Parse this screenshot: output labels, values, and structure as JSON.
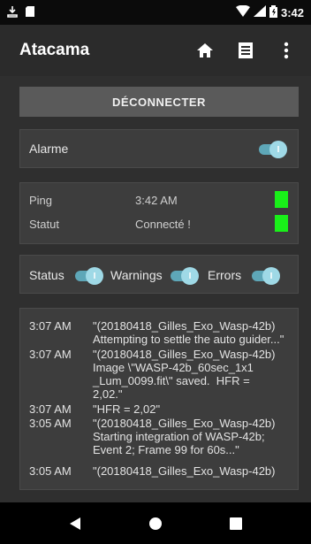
{
  "statusbar": {
    "time": "3:42"
  },
  "appbar": {
    "title": "Atacama"
  },
  "disconnect": {
    "label": "DÉCONNECTER"
  },
  "alarm": {
    "label": "Alarme",
    "enabled": true
  },
  "status_card": {
    "ping_label": "Ping",
    "ping_value": "3:42 AM",
    "status_label": "Statut",
    "status_value": "Connecté !"
  },
  "filters": [
    {
      "label": "Status",
      "enabled": true
    },
    {
      "label": "Warnings",
      "enabled": true
    },
    {
      "label": "Errors",
      "enabled": true
    }
  ],
  "log": [
    {
      "time": "3:07 AM",
      "message": "\"(20180418_Gilles_Exo_Wasp-42b)\nAttempting to settle the auto guider...\""
    },
    {
      "time": "3:07 AM",
      "message": "\"(20180418_Gilles_Exo_Wasp-42b)\nImage \\\"WASP-42b_60sec_1x1\n_Lum_0099.fit\\\" saved.  HFR =\n2,02.\""
    },
    {
      "time": "3:07 AM",
      "message": "\"HFR = 2,02\""
    },
    {
      "time": "3:05 AM",
      "message": "\"(20180418_Gilles_Exo_Wasp-42b)\nStarting integration of WASP-42b;\nEvent 2; Frame 99 for 60s...\""
    },
    {
      "time": "3:05 AM",
      "message": "\"(20180418_Gilles_Exo_Wasp-42b)"
    }
  ],
  "colors": {
    "status_ok": "#19f019",
    "toggle_on": "#5ea7b8"
  }
}
